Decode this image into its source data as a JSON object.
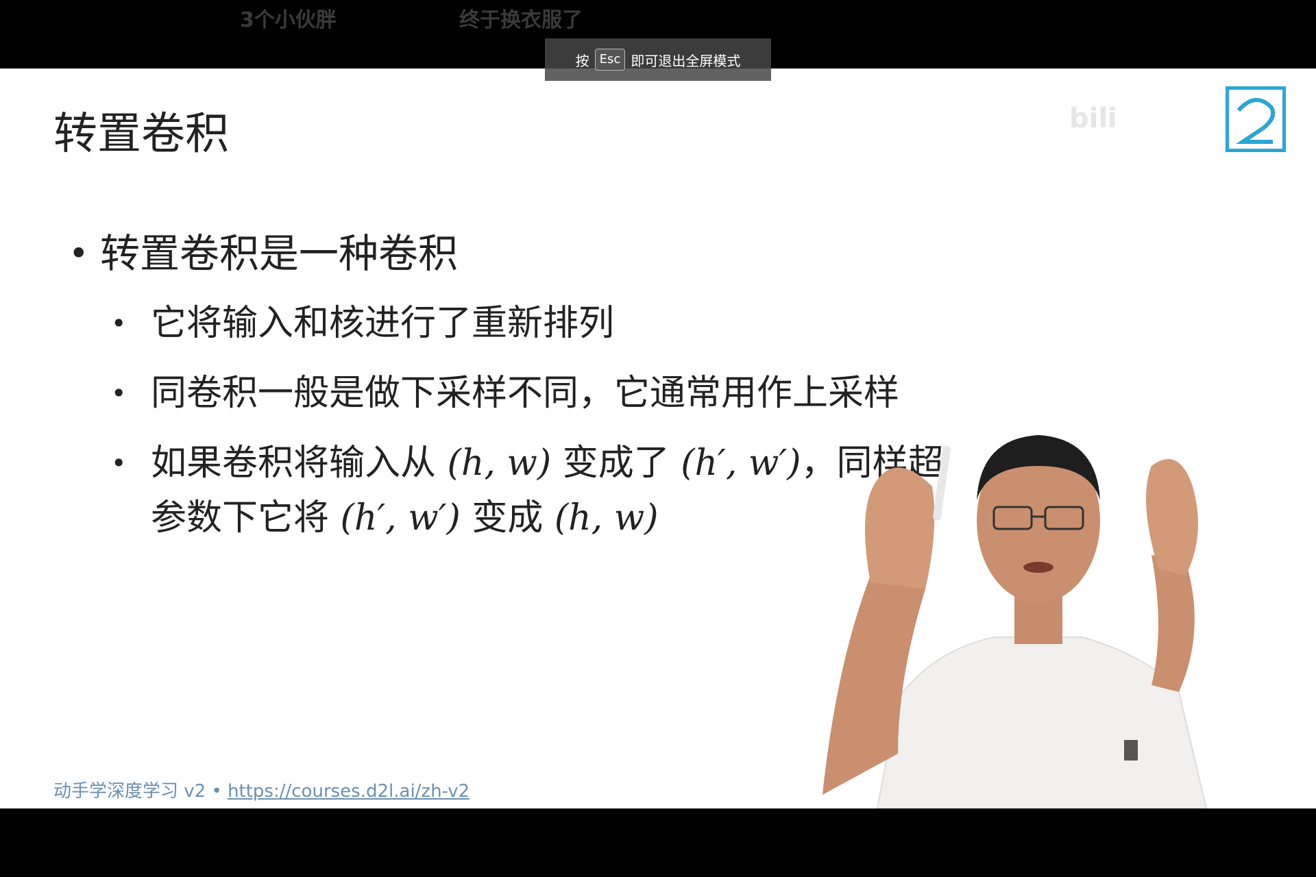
{
  "danmaku": [
    "3个小伙胖",
    "终于换衣服了"
  ],
  "esc_hint": {
    "prefix": "按",
    "key": "Esc",
    "suffix": "即可退出全屏模式"
  },
  "slide": {
    "title": "转置卷积",
    "bullets": [
      "转置卷积是一种卷积",
      "它将输入和核进行了重新排列",
      "同卷积一般是做下采样不同，它通常用作上采样",
      "如果卷积将输入从",
      "(h, w)",
      "变成了",
      "(h′, w′)",
      "，同样超",
      "参数下它将",
      "(h′, w′)",
      "变成",
      "(h, w)"
    ],
    "footer_text": "动手学深度学习 v2 • ",
    "footer_link": "https://courses.d2l.ai/zh-v2",
    "watermark": "bili"
  },
  "colors": {
    "accent": "#2aa6d4",
    "footer": "#6b8fb3",
    "background": "#ffffff"
  }
}
